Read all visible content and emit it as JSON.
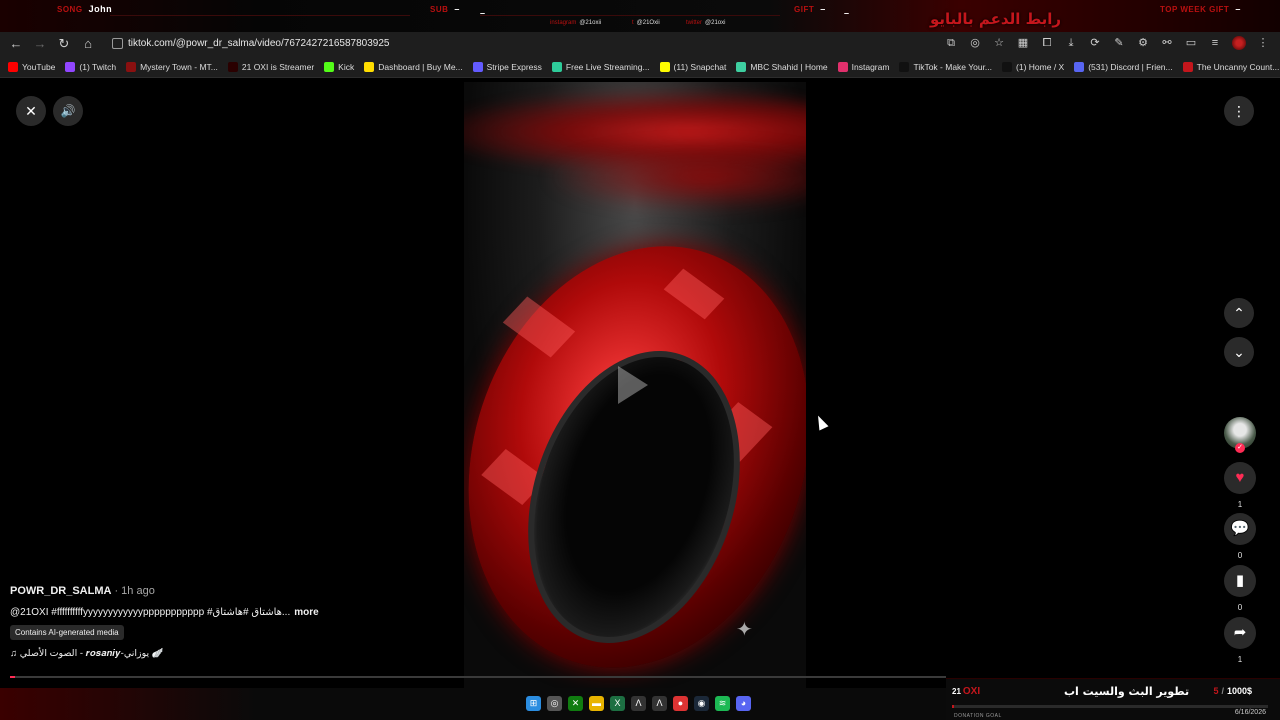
{
  "overlay": {
    "song_label": "SONG",
    "song_value": "John",
    "sub_label": "SUB",
    "sub_value": "–",
    "sub_value2": "–",
    "gift_label": "GIFT",
    "gift_value": "–",
    "gift_value2": "–",
    "top_gift_label": "TOP WEEK GIFT",
    "top_gift_value": "–",
    "arabic_banner": "رابط الدعم بالبايو",
    "socials": [
      {
        "tag": "instagram",
        "handle": "@21oxii"
      },
      {
        "tag": "t",
        "handle": "@21Oxii"
      },
      {
        "tag": "twitter",
        "handle": "@21oxi"
      }
    ]
  },
  "browser": {
    "url": "tiktok.com/@powr_dr_salma/video/7672427216587803925",
    "bookmarks": [
      {
        "label": "YouTube",
        "icon": "youtube-icon",
        "color": "#ff0000"
      },
      {
        "label": "(1) Twitch",
        "icon": "twitch-icon",
        "color": "#9146ff"
      },
      {
        "label": "Mystery Town - MT...",
        "icon": "mystery-town-icon",
        "color": "#8a1010"
      },
      {
        "label": "21 OXI is Streamer",
        "icon": "oxi-icon",
        "color": "#2a0000"
      },
      {
        "label": "Kick",
        "icon": "kick-icon",
        "color": "#53fc18"
      },
      {
        "label": "Dashboard | Buy Me...",
        "icon": "buymeacoffee-icon",
        "color": "#ffdd00"
      },
      {
        "label": "Stripe Express",
        "icon": "stripe-icon",
        "color": "#635bff"
      },
      {
        "label": "Free Live Streaming...",
        "icon": "streaming-icon",
        "color": "#2ecc9a"
      },
      {
        "label": "(11) Snapchat",
        "icon": "snapchat-icon",
        "color": "#fffc00"
      },
      {
        "label": "MBC Shahid | Home",
        "icon": "shahid-icon",
        "color": "#3ecfa0"
      },
      {
        "label": "Instagram",
        "icon": "instagram-icon",
        "color": "#e1306c"
      },
      {
        "label": "TikTok - Make Your...",
        "icon": "tiktok-icon",
        "color": "#111111"
      },
      {
        "label": "(1) Home / X",
        "icon": "x-icon",
        "color": "#111111"
      },
      {
        "label": "(531) Discord | Frien...",
        "icon": "discord-icon",
        "color": "#5865f2"
      },
      {
        "label": "The Uncanny Count...",
        "icon": "uncanny-icon",
        "color": "#c4161c"
      }
    ]
  },
  "video": {
    "author": "POWR_DR_SALMA",
    "time": "· 1h ago",
    "description": "@21OXI #ffffffffffyyyyyyyyyyyyppppppppppp #هاشتاق #هاشتاق...",
    "more_label": "more",
    "ai_badge": "Contains AI-generated media",
    "music": "♫  الصوت الأصلي - 𝒓𝒐𝒔𝒂𝒏𝒊𝒚-يوزاني 🪽",
    "progress_percent": 0.5
  },
  "actions": {
    "likes": "1",
    "comments": "0",
    "saves": "0",
    "shares": "1"
  },
  "donation": {
    "logo_num": "21",
    "logo_text": "OXI",
    "title": "تطوير البث والسيت اب",
    "current": "5",
    "goal": "1000$",
    "label": "DONATION GOAL",
    "date": "6/16/2026",
    "fill_fraction": 0.005
  }
}
